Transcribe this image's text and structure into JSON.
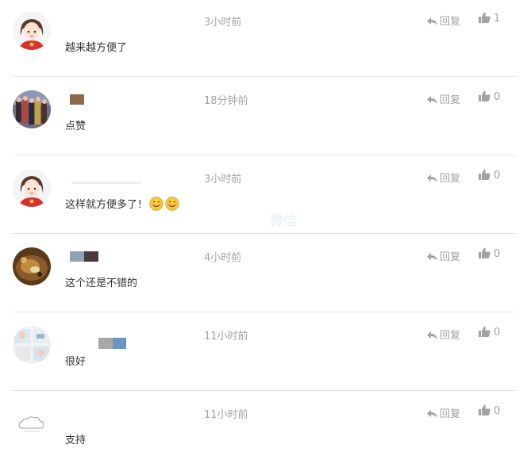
{
  "colors": {
    "text_primary": "#333333",
    "text_meta": "#a3a3a3",
    "divider": "#e6e6e6"
  },
  "watermark": {
    "line1": "微信",
    "line2": ""
  },
  "comments": [
    {
      "avatar": "cartoon-girl-avatar",
      "timestamp": "3小时前",
      "reply_label": "回复",
      "likes": "1",
      "text": "越来越方便了",
      "emojis": 0
    },
    {
      "avatar": "group-photo-avatar",
      "timestamp": "18分钟前",
      "reply_label": "回复",
      "likes": "0",
      "text": "点赞",
      "emojis": 0
    },
    {
      "avatar": "cartoon-girl-avatar",
      "timestamp": "3小时前",
      "reply_label": "回复",
      "likes": "0",
      "text": "这样就方便多了！",
      "emojis": 2
    },
    {
      "avatar": "food-photo-avatar",
      "timestamp": "4小时前",
      "reply_label": "回复",
      "likes": "0",
      "text": "这个还是不错的",
      "emojis": 0
    },
    {
      "avatar": "collage-photo-avatar",
      "timestamp": "11小时前",
      "reply_label": "回复",
      "likes": "0",
      "text": "很好",
      "emojis": 0
    },
    {
      "avatar": "cloud-sketch-avatar",
      "timestamp": "11小时前",
      "reply_label": "回复",
      "likes": "0",
      "text": "支持",
      "emojis": 0
    }
  ]
}
